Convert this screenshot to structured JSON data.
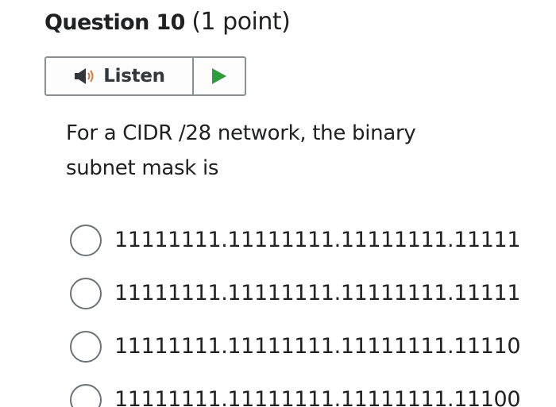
{
  "question": {
    "title": "Question 10",
    "points": "(1 point)",
    "text": "For a CIDR /28 network, the binary subnet mask is"
  },
  "listen_widget": {
    "label": "Listen",
    "speaker_icon": "speaker-icon",
    "play_icon": "play-icon",
    "speaker_color": "#33373b",
    "speaker_wave_color": "#e0763a",
    "play_color": "#2e9b3e"
  },
  "options": [
    {
      "text": "11111111.11111111.11111111.11111"
    },
    {
      "text": "11111111.11111111.11111111.11111"
    },
    {
      "text": "11111111.11111111.11111111.11110"
    },
    {
      "text": "11111111.11111111.11111111.11100"
    }
  ]
}
